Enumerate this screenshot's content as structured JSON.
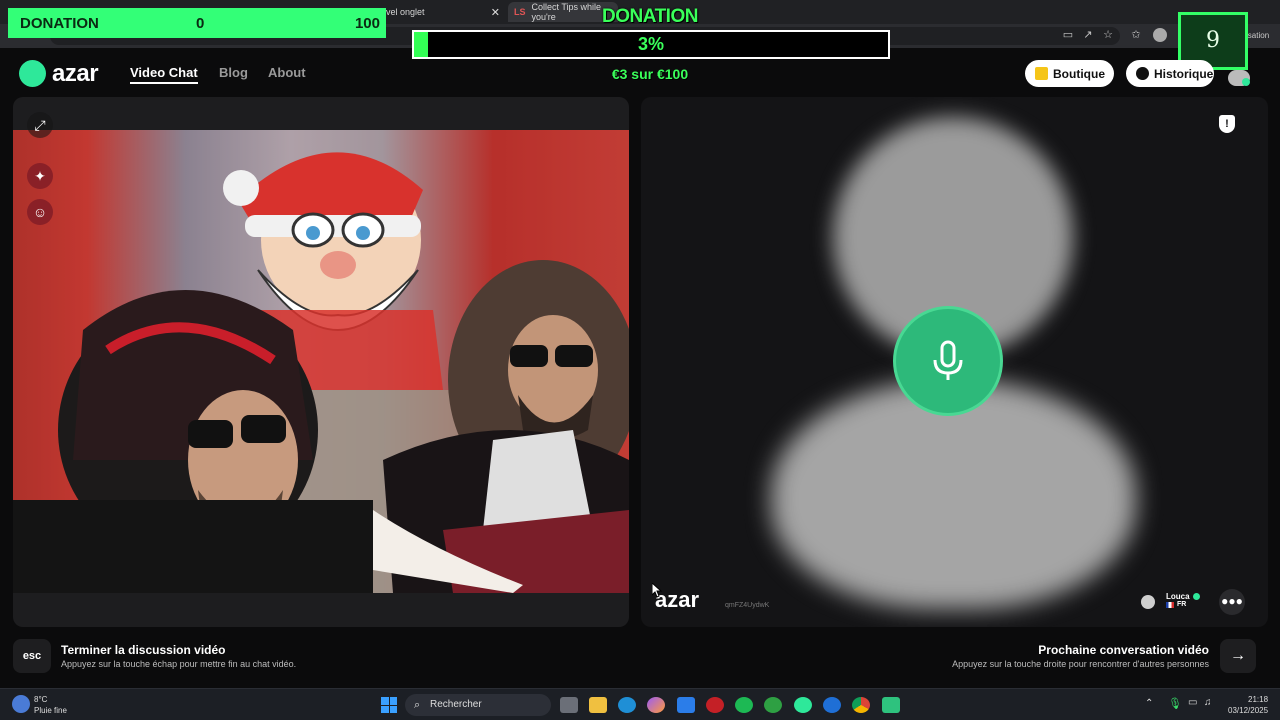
{
  "browser": {
    "tabs": [
      {
        "title": "vel onglet"
      },
      {
        "title": "Collect Tips while you're"
      }
    ],
    "conversation_label": "Conversation"
  },
  "donation_overlay": {
    "bar_label": "DONATION",
    "bar_min": "0",
    "bar_max": "100",
    "goal_title": "DONATION",
    "progress_percent_text": "3%",
    "progress_fraction": 0.03,
    "amount_text": "€3 sur €100",
    "counter": "9"
  },
  "header": {
    "brand": "azar",
    "nav": [
      {
        "label": "Video Chat",
        "active": true
      },
      {
        "label": "Blog",
        "active": false
      },
      {
        "label": "About",
        "active": false
      }
    ],
    "shop_label": "Boutique",
    "history_label": "Historique"
  },
  "left_panel": {
    "buttons": [
      "expand-icon",
      "sparkle-effects-icon",
      "face-filter-icon"
    ]
  },
  "right_panel": {
    "watermark": "azar",
    "watermark_id": "qmFZ4UydwK",
    "partner_name": "Louca",
    "partner_country": "FR",
    "report_icon": "!"
  },
  "bottom_hints": {
    "esc_key": "esc",
    "end_title": "Terminer la discussion vidéo",
    "end_desc": "Appuyez sur la touche échap pour mettre fin au chat vidéo.",
    "next_title": "Prochaine conversation vidéo",
    "next_desc": "Appuyez sur la touche droite pour rencontrer d'autres personnes",
    "next_key": "→"
  },
  "taskbar": {
    "weather_temp": "8°C",
    "weather_desc": "Pluie fine",
    "search_placeholder": "Rechercher",
    "time": "21:18",
    "date": "03/12/2025"
  },
  "colors": {
    "accent": "#2ee89a",
    "donation_green": "#33ff55",
    "mic_green": "#2db97a"
  }
}
